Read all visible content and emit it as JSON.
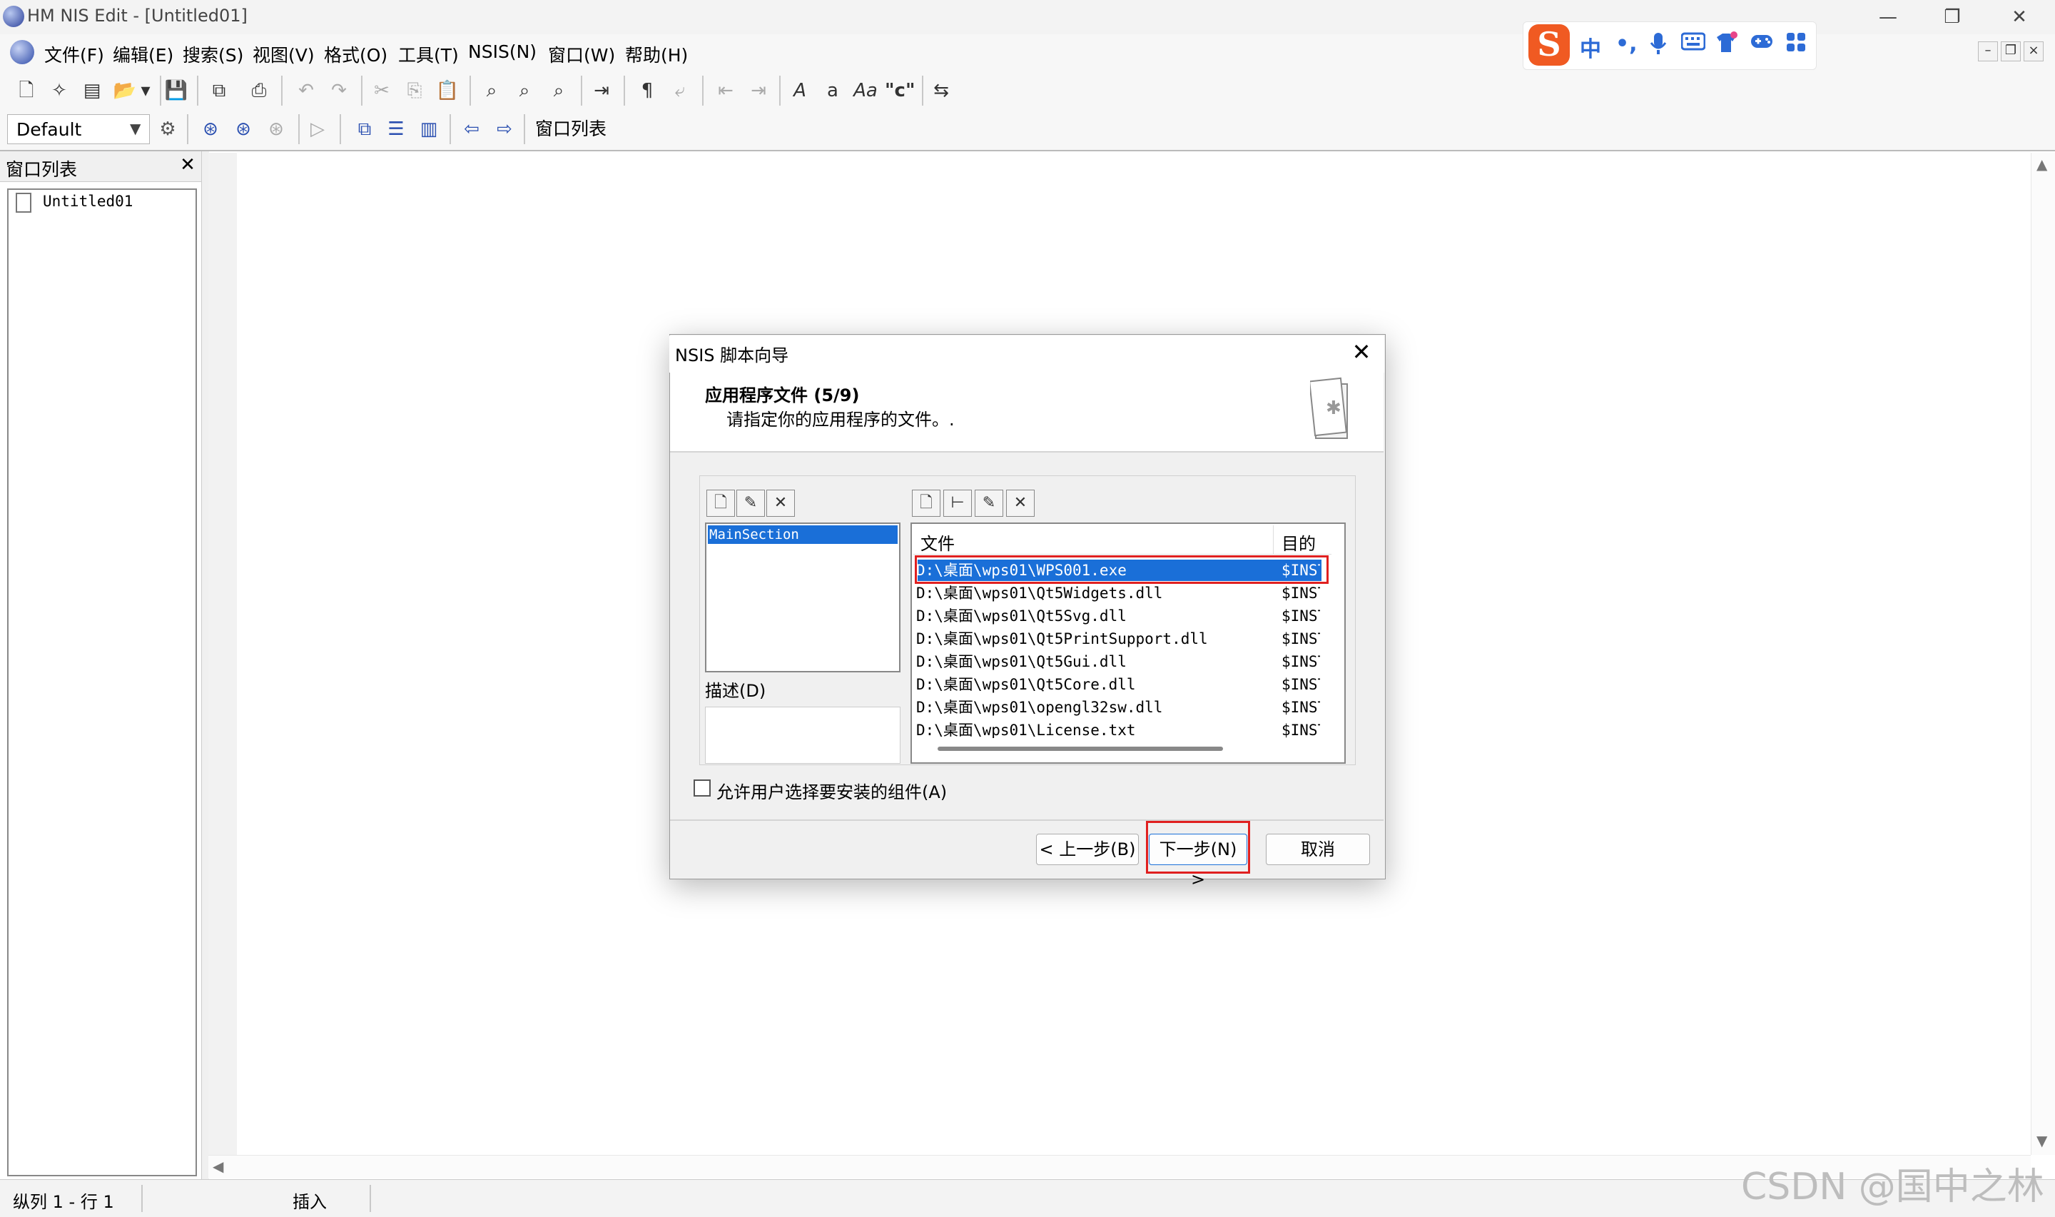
{
  "window": {
    "title": "HM NIS Edit - [Untitled01]",
    "minimize": "—",
    "restore": "❐",
    "close": "✕"
  },
  "menu": {
    "items": [
      {
        "label": "文件(F)"
      },
      {
        "label": "编辑(E)"
      },
      {
        "label": "搜索(S)"
      },
      {
        "label": "视图(V)"
      },
      {
        "label": "格式(O)"
      },
      {
        "label": "工具(T)"
      },
      {
        "label": "NSIS(N)"
      },
      {
        "label": "窗口(W)"
      },
      {
        "label": "帮助(H)"
      }
    ]
  },
  "ime": {
    "logo": "S",
    "mode": "中",
    "punct": "•,"
  },
  "toolbar": {
    "scheme": "Default",
    "window_list_label": "窗口列表",
    "icons": [
      "new-file-icon",
      "wizard-icon",
      "template-icon",
      "open-icon",
      "save-icon",
      "save-all-icon",
      "print-icon",
      "undo-icon",
      "redo-icon",
      "cut-icon",
      "copy-icon",
      "paste-icon",
      "find-icon",
      "find-next-icon",
      "replace-icon",
      "goto-icon",
      "paragraph-icon",
      "wrap-icon",
      "indent-icon",
      "outdent-icon",
      "font-icon",
      "lowercase-icon",
      "case-icon",
      "quote-icon",
      "word-wrap-icon"
    ]
  },
  "panel": {
    "title": "窗口列表",
    "close": "✕",
    "items": [
      {
        "label": "Untitled01"
      }
    ]
  },
  "status": {
    "position": "纵列 1 - 行 1",
    "mode": "插入"
  },
  "dialog": {
    "title": "NSIS 脚本向导",
    "close": "✕",
    "heading": "应用程序文件 (5/9)",
    "subheading": "请指定你的应用程序的文件。.",
    "sections": [
      {
        "label": "MainSection"
      }
    ],
    "description_label": "描述(D)",
    "columns": {
      "file": "文件",
      "dest": "目的"
    },
    "files": [
      {
        "path": "D:\\桌面\\wps01\\WPS001.exe",
        "dest": "$INSTDIR"
      },
      {
        "path": "D:\\桌面\\wps01\\Qt5Widgets.dll",
        "dest": "$INSTDIR"
      },
      {
        "path": "D:\\桌面\\wps01\\Qt5Svg.dll",
        "dest": "$INSTDIR"
      },
      {
        "path": "D:\\桌面\\wps01\\Qt5PrintSupport.dll",
        "dest": "$INSTDIR"
      },
      {
        "path": "D:\\桌面\\wps01\\Qt5Gui.dll",
        "dest": "$INSTDIR"
      },
      {
        "path": "D:\\桌面\\wps01\\Qt5Core.dll",
        "dest": "$INSTDIR"
      },
      {
        "path": "D:\\桌面\\wps01\\opengl32sw.dll",
        "dest": "$INSTDIR"
      },
      {
        "path": "D:\\桌面\\wps01\\License.txt",
        "dest": "$INSTDIR"
      }
    ],
    "allow_user_select": "允许用户选择要安装的组件(A)",
    "buttons": {
      "back": "< 上一步(B)",
      "next": "下一步(N) >",
      "cancel": "取消"
    }
  },
  "watermark": "CSDN @国中之林"
}
